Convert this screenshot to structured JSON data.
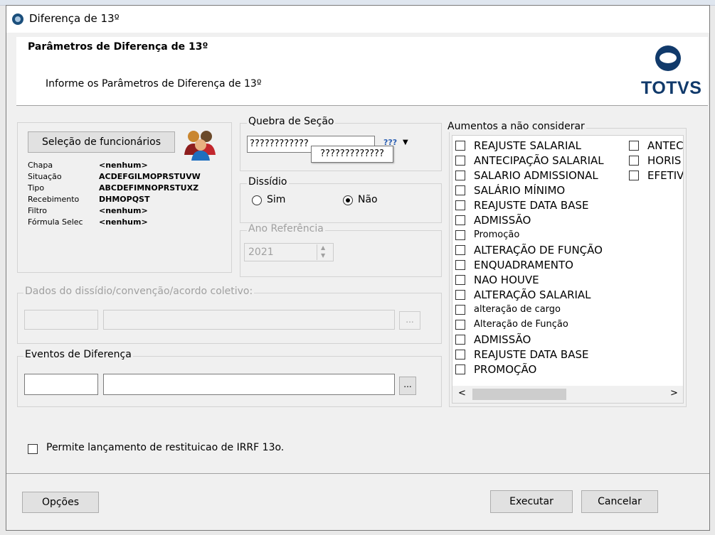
{
  "window": {
    "title": "Diferença de 13º"
  },
  "header": {
    "title": "Parâmetros de Diferença de 13º",
    "subtitle": "Informe os Parâmetros de Diferença de 13º",
    "logo_text": "TOTVS"
  },
  "selecao": {
    "button_label": "Seleção de funcionários",
    "fields": [
      {
        "label": "Chapa",
        "value": "<nenhum>"
      },
      {
        "label": "Situação",
        "value": "ACDEFGILMOPRSTUVW"
      },
      {
        "label": "Tipo",
        "value": "ABCDEFIMNOPRSTUXZ"
      },
      {
        "label": "Recebimento",
        "value": "DHMOPQST"
      },
      {
        "label": "Filtro",
        "value": "<nenhum>"
      },
      {
        "label": "Fórmula Selec",
        "value": "<nenhum>"
      }
    ]
  },
  "quebra": {
    "legend": "Quebra de Seção",
    "value": "????????????",
    "tooltip": "?????????????",
    "icon_text": "???"
  },
  "dissidio": {
    "legend": "Dissídio",
    "option_sim": "Sim",
    "option_nao": "Não",
    "selected": "Não"
  },
  "ano_referencia": {
    "legend": "Ano Referência",
    "value": "2021"
  },
  "dados_dissidio": {
    "legend": "Dados do dissídio/convenção/acordo coletivo:",
    "browse_label": "..."
  },
  "eventos": {
    "legend": "Eventos de Diferença",
    "browse_label": "..."
  },
  "aumentos": {
    "legend": "Aumentos a não considerar",
    "col1": [
      {
        "label": "REAJUSTE SALARIAL",
        "small": false
      },
      {
        "label": "ANTECIPAÇÃO SALARIAL",
        "small": false
      },
      {
        "label": "SALARIO ADMISSIONAL",
        "small": false
      },
      {
        "label": "SALÁRIO MÍNIMO",
        "small": false
      },
      {
        "label": "REAJUSTE DATA BASE",
        "small": false
      },
      {
        "label": "ADMISSÃO",
        "small": false
      },
      {
        "label": "Promoção",
        "small": true
      },
      {
        "label": "ALTERAÇÃO DE FUNÇÃO",
        "small": false
      },
      {
        "label": "ENQUADRAMENTO",
        "small": false
      },
      {
        "label": "NAO HOUVE",
        "small": false
      },
      {
        "label": "ALTERAÇÃO SALARIAL",
        "small": false
      },
      {
        "label": "alteração de cargo",
        "small": true
      },
      {
        "label": "Alteração de Função",
        "small": true
      },
      {
        "label": "ADMISSÃO",
        "small": false
      },
      {
        "label": "REAJUSTE DATA BASE",
        "small": false
      },
      {
        "label": "PROMOÇÃO",
        "small": false
      }
    ],
    "col2": [
      {
        "label": "ANTEC"
      },
      {
        "label": "HORIS"
      },
      {
        "label": "EFETIV"
      }
    ],
    "scroll_left": "<",
    "scroll_right": ">"
  },
  "irrf": {
    "label": "Permite lançamento de restituicao de IRRF 13o."
  },
  "footer": {
    "options_label": "Opções",
    "execute_label": "Executar",
    "cancel_label": "Cancelar"
  }
}
